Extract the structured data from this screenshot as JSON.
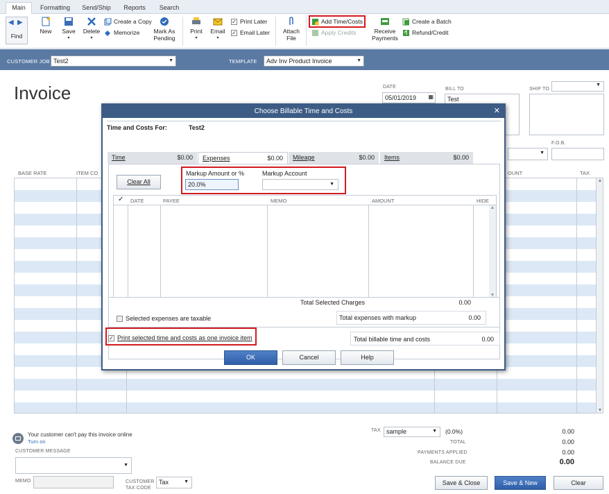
{
  "ribbon": {
    "tabs": [
      "Main",
      "Formatting",
      "Send/Ship",
      "Reports",
      "Search"
    ],
    "buttons": {
      "find": "Find",
      "new": "New",
      "save": "Save",
      "delete": "Delete",
      "create_copy": "Create a Copy",
      "memorize": "Memorize",
      "mark_as_pending_1": "Mark As",
      "mark_as_pending_2": "Pending",
      "print": "Print",
      "email": "Email",
      "print_later": "Print Later",
      "email_later": "Email Later",
      "attach_file_1": "Attach",
      "attach_file_2": "File",
      "add_time_costs": "Add Time/Costs",
      "apply_credits": "Apply Credits",
      "receive_payments_1": "Receive",
      "receive_payments_2": "Payments",
      "create_batch": "Create a Batch",
      "refund_credit": "Refund/Credit"
    }
  },
  "customer_bar": {
    "customer_job_label": "CUSTOMER JOB",
    "customer_job_value": "Test2",
    "template_label": "TEMPLATE",
    "template_value": "Adv Inv Product Invoice"
  },
  "invoice": {
    "title": "Invoice",
    "date_label": "DATE",
    "date_value": "05/01/2019",
    "bill_to_label": "BILL TO",
    "bill_to_value": "Test",
    "ship_to_label": "SHIP TO",
    "fob_label": "F.O.B.",
    "col_base_rate": "BASE RATE",
    "col_item_code": "ITEM CO",
    "col_amount": "OUNT",
    "col_tax": "TAX",
    "pay_online_text": "Your customer can't pay this invoice online",
    "turn_on": "Turn on",
    "customer_message_label": "CUSTOMER MESSAGE",
    "memo_label": "MEMO",
    "customer_tax_code_label_1": "CUSTOMER",
    "customer_tax_code_label_2": "TAX CODE",
    "tax_code_value": "Tax",
    "tax_label": "TAX",
    "tax_value": "sample",
    "tax_rate": "(0.0%)",
    "tax_amount": "0.00",
    "total_label": "TOTAL",
    "total_value": "0.00",
    "payments_applied_label": "PAYMENTS APPLIED",
    "payments_applied_value": "0.00",
    "balance_due_label": "BALANCE DUE",
    "balance_due_value": "0.00",
    "save_close": "Save & Close",
    "save_new": "Save & New",
    "clear": "Clear"
  },
  "dialog": {
    "title": "Choose Billable Time and Costs",
    "time_costs_for_label": "Time and Costs For:",
    "time_costs_for_value": "Test2",
    "tabs": [
      {
        "label": "Time",
        "amount": "$0.00"
      },
      {
        "label": "Expenses",
        "amount": "$0.00"
      },
      {
        "label": "Mileage",
        "amount": "$0.00"
      },
      {
        "label": "Items",
        "amount": "$0.00"
      }
    ],
    "clear_all": "Clear All",
    "markup_amount_label": "Markup Amount or %",
    "markup_amount_value": "20.0%",
    "markup_account_label": "Markup Account",
    "markup_account_value": "",
    "columns": [
      "DATE",
      "PAYEE",
      "MEMO",
      "AMOUNT",
      "HIDE"
    ],
    "check_col": "✓",
    "total_selected_label": "Total Selected Charges",
    "total_selected_value": "0.00",
    "taxable_label": "Selected expenses are taxable",
    "total_markup_label": "Total expenses with markup",
    "total_markup_value": "0.00",
    "print_one_item_label": "Print selected time and costs as one invoice item",
    "total_billable_label": "Total billable time and costs",
    "total_billable_value": "0.00",
    "ok": "OK",
    "cancel": "Cancel",
    "help": "Help"
  }
}
